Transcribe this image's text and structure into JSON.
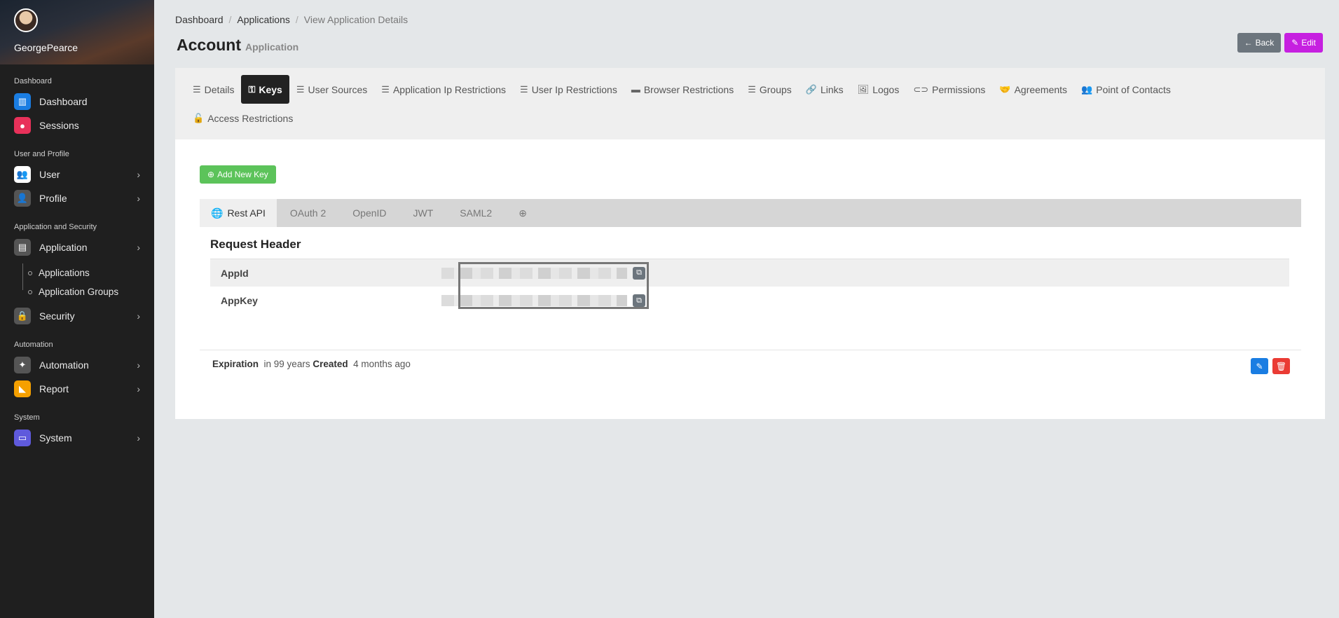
{
  "user": {
    "name": "GeorgePearce"
  },
  "sidebar": {
    "sections": {
      "dashboard": "Dashboard",
      "user_profile": "User and Profile",
      "app_security": "Application and Security",
      "automation": "Automation",
      "system": "System"
    },
    "items": {
      "dashboard": "Dashboard",
      "sessions": "Sessions",
      "user": "User",
      "profile": "Profile",
      "application": "Application",
      "applications": "Applications",
      "application_groups": "Application Groups",
      "security": "Security",
      "automation": "Automation",
      "report": "Report",
      "system": "System"
    },
    "colors": {
      "dashboard": "#1a7de2",
      "sessions": "#e8315a",
      "user": "#ffffff",
      "profile": "#555555",
      "application": "#555555",
      "security": "#555555",
      "automation": "#555555",
      "report": "#f5a000",
      "system": "#5f5adc"
    }
  },
  "breadcrumb": [
    "Dashboard",
    "Applications",
    "View Application Details"
  ],
  "page": {
    "title": "Account",
    "subtitle": "Application"
  },
  "actions": {
    "back": "Back",
    "edit": "Edit"
  },
  "tabs": [
    "Details",
    "Keys",
    "User Sources",
    "Application Ip Restrictions",
    "User Ip Restrictions",
    "Browser Restrictions",
    "Groups",
    "Links",
    "Logos",
    "Permissions",
    "Agreements",
    "Point of Contacts",
    "Access Restrictions"
  ],
  "keys": {
    "add_button": "Add New Key",
    "sub_tabs": [
      "Rest API",
      "OAuth 2",
      "OpenID",
      "JWT",
      "SAML2"
    ],
    "section_title": "Request Header",
    "fields": [
      "AppId",
      "AppKey"
    ],
    "expiration_label": "Expiration",
    "expiration_value": "in 99 years",
    "created_label": "Created",
    "created_value": "4 months ago"
  }
}
